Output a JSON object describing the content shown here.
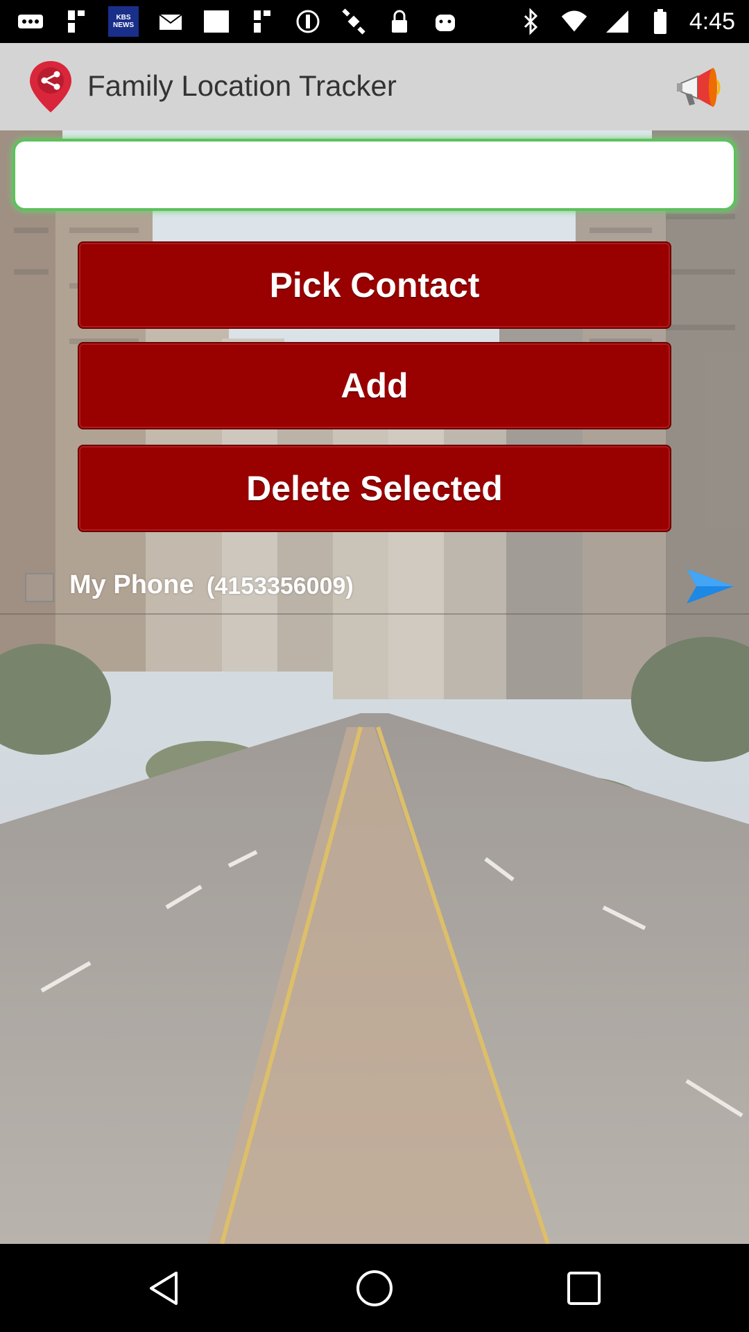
{
  "status_bar": {
    "time": "4:45",
    "left_icons": [
      "more-icon",
      "fake-gps-icon",
      "kbs-news-icon",
      "mail-icon",
      "blank-icon",
      "fake-gps-icon",
      "block-icon",
      "satellite-icon",
      "lock-icon",
      "android-icon"
    ],
    "right_icons": [
      "bluetooth-icon",
      "wifi-icon",
      "signal-icon",
      "battery-icon"
    ],
    "kbs_label_line1": "KBS",
    "kbs_label_line2": "NEWS"
  },
  "app_bar": {
    "title": "Family Location Tracker",
    "logo_icon": "share-location-icon",
    "action_icon": "megaphone-icon"
  },
  "search": {
    "value": "",
    "placeholder": ""
  },
  "buttons": {
    "pick_contact": "Pick Contact",
    "add": "Add",
    "delete_selected": "Delete Selected"
  },
  "contacts": [
    {
      "name": "My Phone",
      "phone": "(4153356009)",
      "checked": false
    }
  ],
  "colors": {
    "button_red": "#990000",
    "input_border": "#5dc15d",
    "appbar_bg": "#d4d4d4",
    "arrow_blue": "#1e88e5"
  },
  "nav_bar": {
    "icons": [
      "back-icon",
      "home-icon",
      "recents-icon"
    ]
  }
}
